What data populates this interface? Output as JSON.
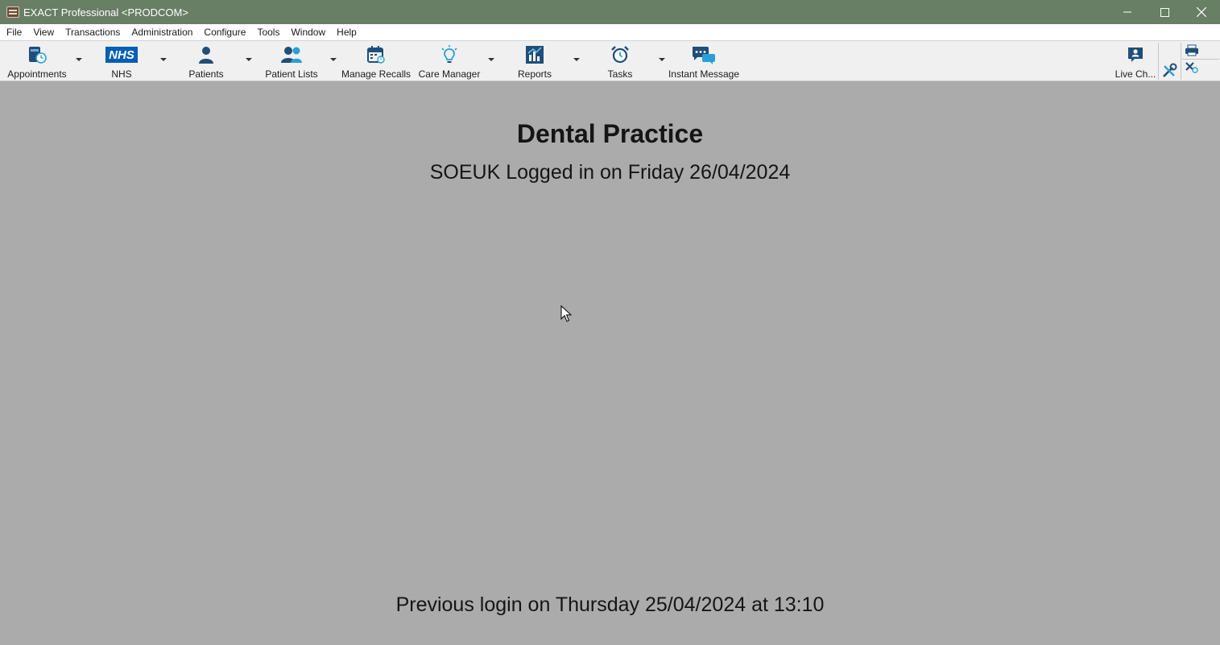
{
  "window": {
    "title": "EXACT Professional <PRODCOM>",
    "controls": [
      "minimize",
      "maximize",
      "close"
    ]
  },
  "menubar": {
    "items": [
      "File",
      "View",
      "Transactions",
      "Administration",
      "Configure",
      "Tools",
      "Window",
      "Help"
    ]
  },
  "toolbar": {
    "appointments": "Appointments",
    "nhs": "NHS",
    "nhs_logo": "NHS",
    "patients": "Patients",
    "patient_lists": "Patient Lists",
    "manage_recalls": "Manage Recalls",
    "care_manager": "Care Manager",
    "reports": "Reports",
    "tasks": "Tasks",
    "instant_message": "Instant Message",
    "live_chat": "Live Ch...",
    "icon_color": "#1f4e79",
    "accent_color": "#2a9fd6"
  },
  "main": {
    "practice_name": "Dental Practice",
    "logged_in": "SOEUK Logged in on Friday 26/04/2024",
    "previous_login": "Previous login on Thursday 25/04/2024 at 13:10"
  }
}
